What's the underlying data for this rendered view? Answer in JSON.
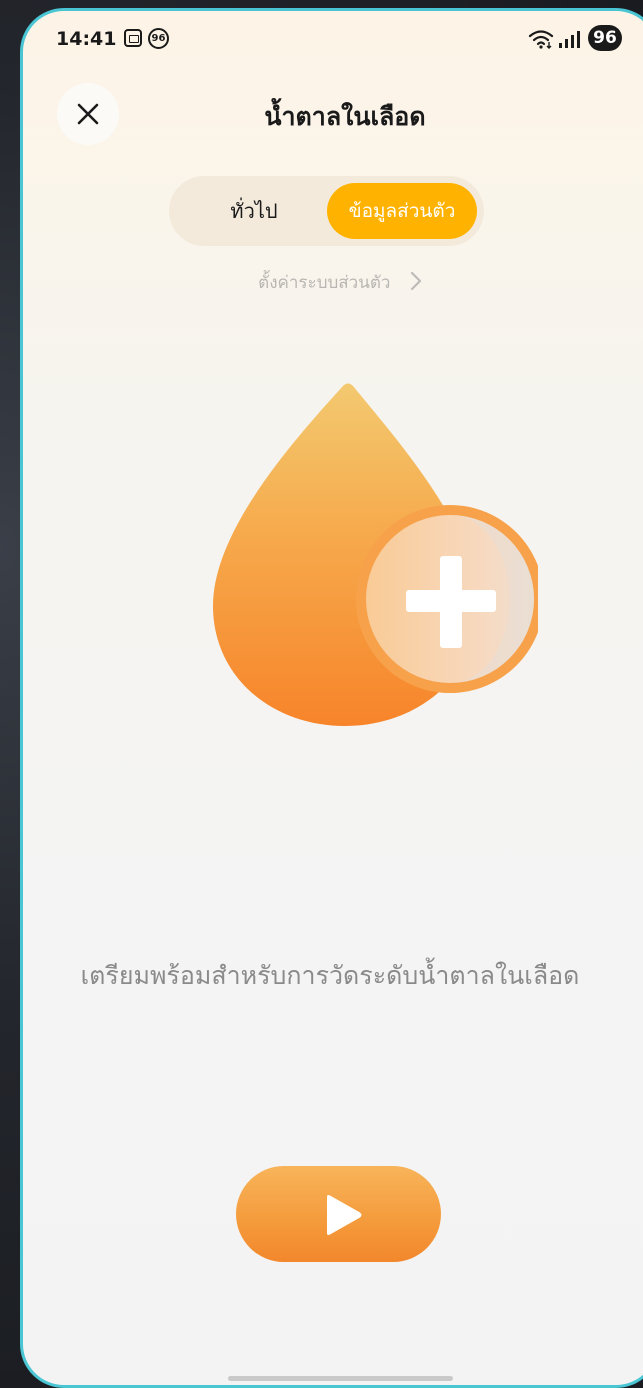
{
  "status_bar": {
    "time": "14:41",
    "notification_badge": "96",
    "battery_level": "96",
    "icons": [
      "screenshot-icon",
      "notification-badge-icon",
      "wifi-icon",
      "signal-icon",
      "battery-icon"
    ]
  },
  "header": {
    "title": "น้ำตาลในเลือด",
    "close_icon": "close-icon"
  },
  "tabs": {
    "general_label": "ทั่วไป",
    "personal_label": "ข้อมูลส่วนตัว",
    "selected": "personal"
  },
  "settings_link": {
    "label": "ตั้งค่าระบบส่วนตัว",
    "icon": "chevron-right-icon"
  },
  "illustration": {
    "icon": "blood-drop-plus-icon"
  },
  "message": "เตรียมพร้อมสำหรับการวัดระดับน้ำตาลในเลือด",
  "start_button": {
    "icon": "play-icon"
  },
  "colors": {
    "accent": "#ffb300",
    "button_gradient_top": "#f8b45a",
    "button_gradient_bottom": "#f2872c",
    "drop_top": "#f3c970",
    "drop_bottom": "#f78a2a",
    "frame_border": "#49c5d3"
  }
}
